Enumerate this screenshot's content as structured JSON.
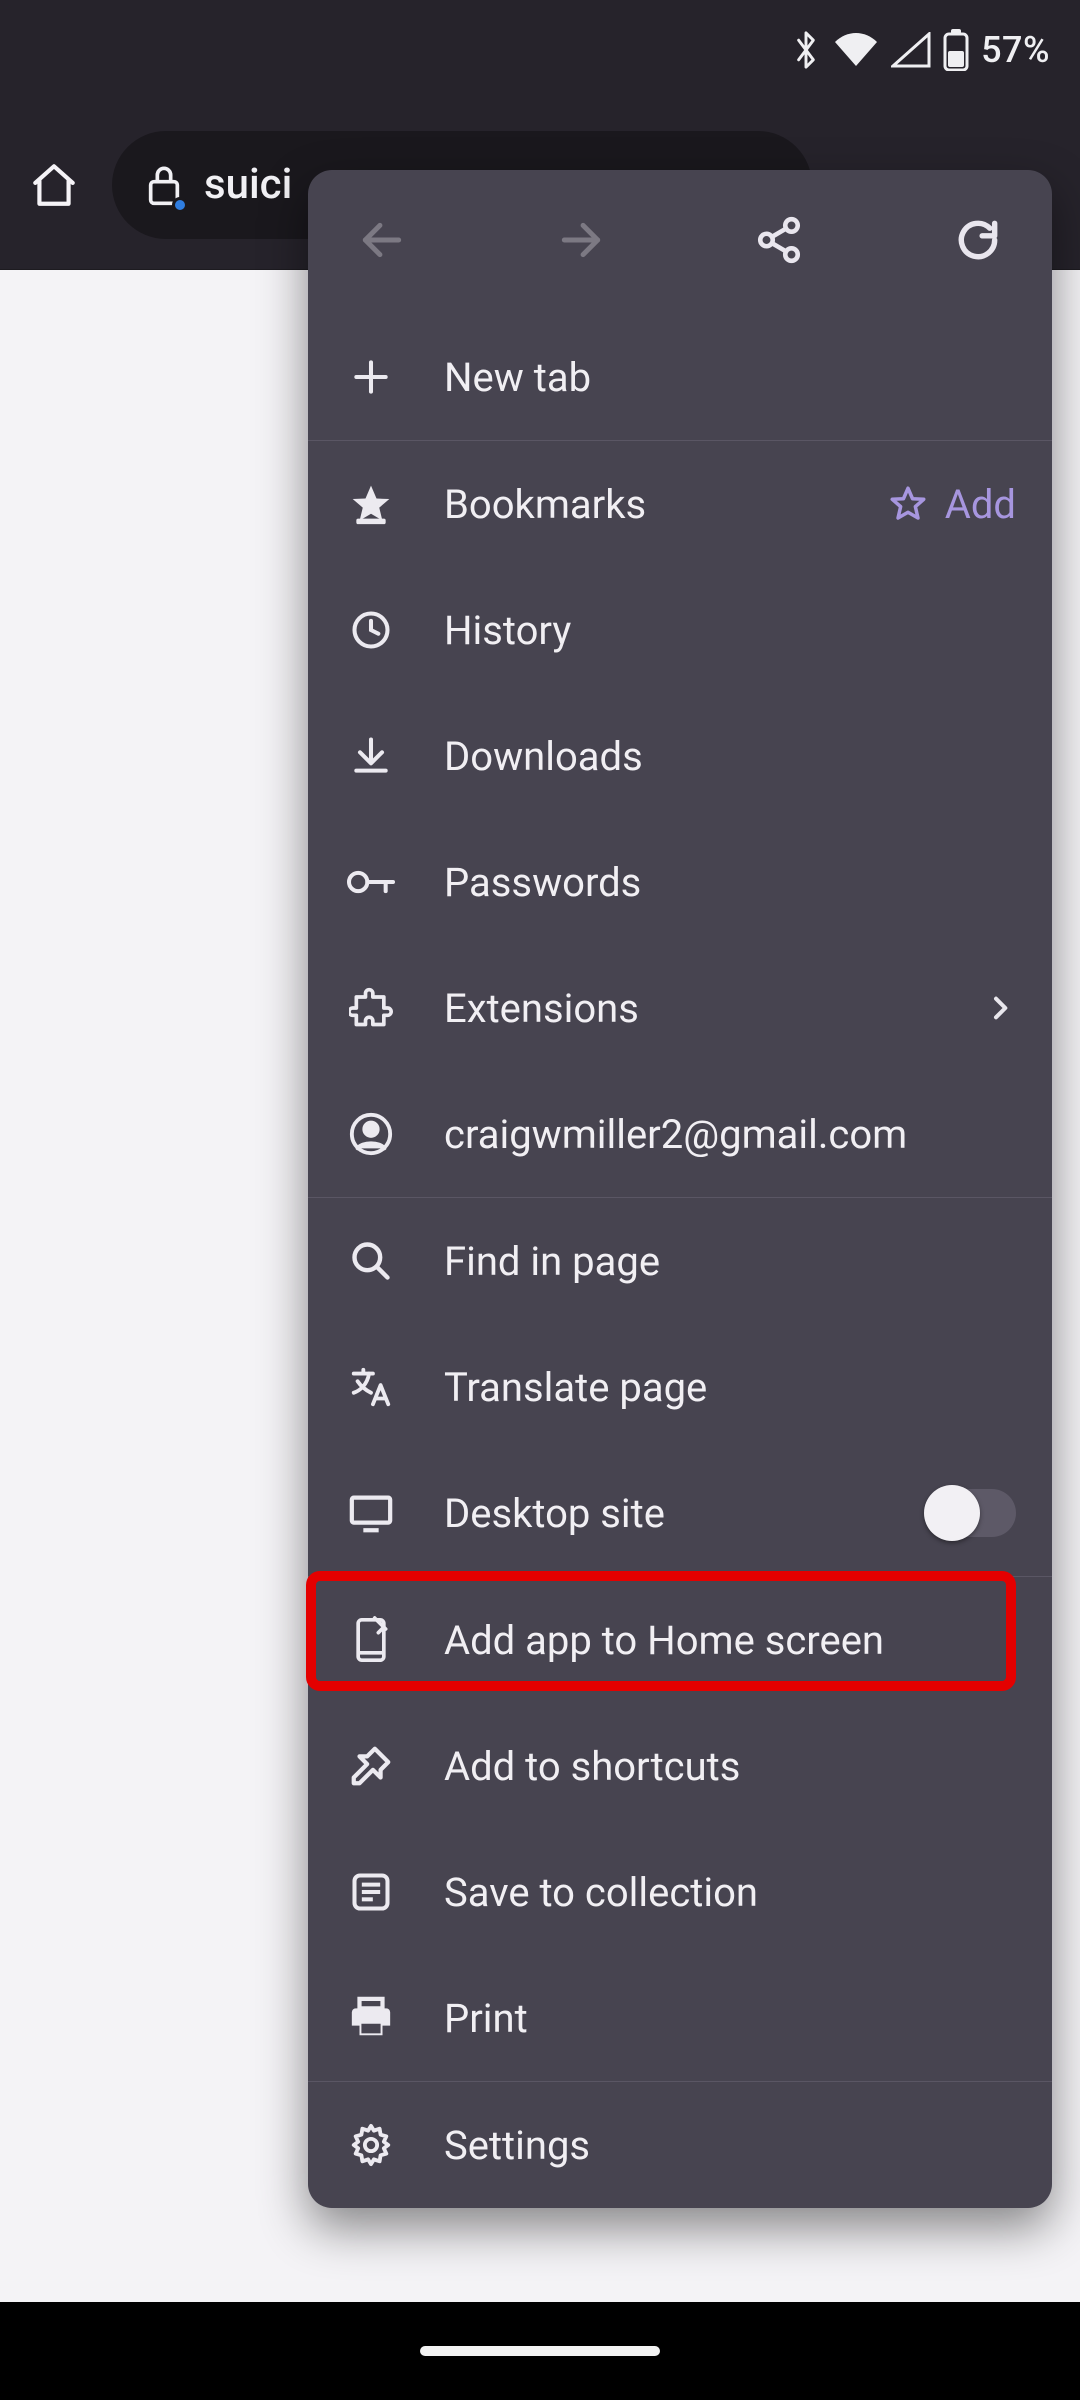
{
  "status_bar": {
    "battery_text": "57%"
  },
  "browser_bar": {
    "url_text": "suici"
  },
  "menu": {
    "new_tab": "New tab",
    "bookmarks": "Bookmarks",
    "bookmarks_add": "Add",
    "history": "History",
    "downloads": "Downloads",
    "passwords": "Passwords",
    "extensions": "Extensions",
    "account": "craigwmiller2@gmail.com",
    "find_in_page": "Find in page",
    "translate": "Translate page",
    "desktop_site": "Desktop site",
    "add_home": "Add app to Home screen",
    "add_shortcuts": "Add to shortcuts",
    "save_collection": "Save to collection",
    "print": "Print",
    "settings": "Settings"
  }
}
